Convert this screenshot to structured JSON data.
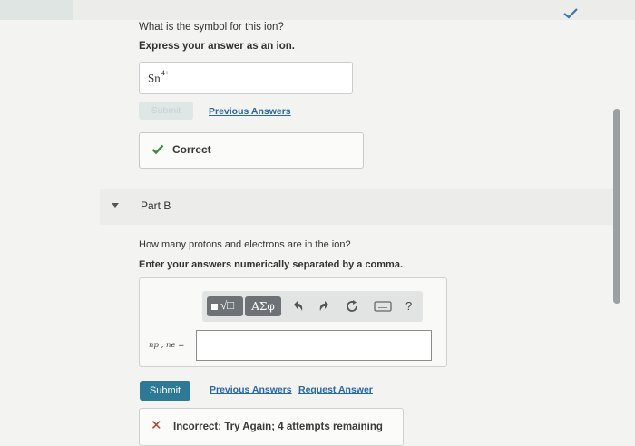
{
  "part_a": {
    "question": "What is the symbol for this ion?",
    "instruction": "Express your answer as an ion.",
    "answer_base": "Sn",
    "answer_charge": "4+",
    "submit_label": "Submit",
    "previous_answers_label": "Previous Answers",
    "feedback": "Correct"
  },
  "part_b": {
    "label": "Part B",
    "question": "How many protons and electrons are in the ion?",
    "instruction": "Enter your answers numerically separated by a comma.",
    "toolbar": {
      "templates_icon": "templates-icon",
      "greek_label": "ΑΣφ",
      "help_label": "?"
    },
    "variable_label": "np , ne =",
    "input_value": "",
    "submit_label": "Submit",
    "previous_answers_label": "Previous Answers",
    "request_answer_label": "Request Answer",
    "feedback": "Incorrect; Try Again; 4 attempts remaining"
  },
  "colors": {
    "link": "#2a67a6",
    "submit_bg": "#2e7a96",
    "correct": "#3c8a3c",
    "incorrect": "#c0392b"
  }
}
